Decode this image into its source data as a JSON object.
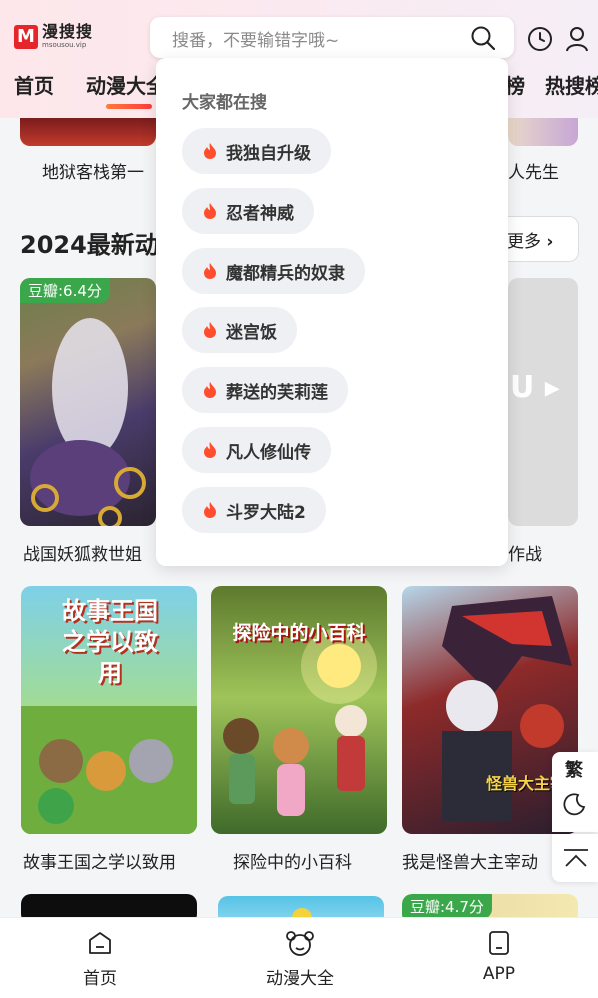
{
  "app": {
    "logo_mark": "M",
    "logo_name": "漫搜搜",
    "logo_domain": "msousou.vip"
  },
  "search": {
    "placeholder": "搜番，不要输错字哦~"
  },
  "nav": {
    "items": [
      "首页",
      "动漫大全",
      "榜",
      "热搜榜"
    ]
  },
  "top_row": {
    "items": [
      {
        "title": "地狱客栈第一"
      },
      {
        "title": "人先生"
      }
    ]
  },
  "section": {
    "title": "2024最新动",
    "more": "更多"
  },
  "row1": {
    "items": [
      {
        "title": "战国妖狐救世姐",
        "badge": "豆瓣:6.4分"
      },
      {
        "title": "作战"
      }
    ]
  },
  "row2": {
    "items": [
      {
        "title": "故事王国之学以致用",
        "cover_text": "故事王国之学以致用"
      },
      {
        "title": "探险中的小百科",
        "cover_text": "探险中的小百科"
      },
      {
        "title": "我是怪兽大主宰动",
        "cover_text": "怪兽大主宰"
      }
    ]
  },
  "row3": {
    "items": [
      {
        "badge": "豆瓣:4.7分"
      }
    ]
  },
  "dropdown": {
    "title": "大家都在搜",
    "items": [
      "我独自升级",
      "忍者神威",
      "魔都精兵的奴隶",
      "迷宫饭",
      "葬送的芙莉莲",
      "凡人修仙传",
      "斗罗大陆2"
    ]
  },
  "side": {
    "traditional": "繁"
  },
  "bottom_nav": {
    "items": [
      "首页",
      "动漫大全",
      "APP"
    ]
  },
  "colors": {
    "accent": "#ff3b3b",
    "badge_green": "#3aa84a",
    "flame": "#ff4d2e"
  }
}
